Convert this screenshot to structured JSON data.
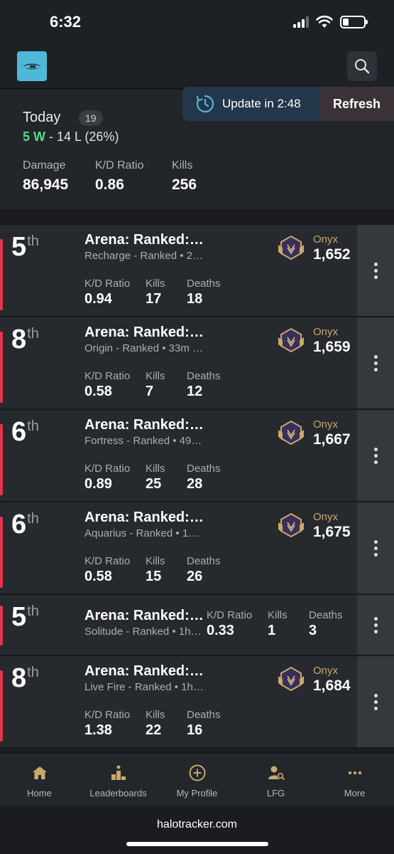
{
  "status_bar": {
    "time": "6:32"
  },
  "summary": {
    "title": "Today",
    "count": "19",
    "wins": "5 W",
    "losses": "14 L",
    "pct": "(26%)",
    "stats": [
      {
        "label": "Damage",
        "value": "86,945"
      },
      {
        "label": "K/D Ratio",
        "value": "0.86"
      },
      {
        "label": "Kills",
        "value": "256"
      }
    ],
    "update_label": "Update in 2:48",
    "refresh_label": "Refresh"
  },
  "matches": [
    {
      "place": "5",
      "suffix": "th",
      "mode": "Arena: Ranked:…",
      "sub": "Recharge - Ranked • 2…",
      "rank_label": "Onyx",
      "rank_value": "1,652",
      "kd_label": "K/D Ratio",
      "kd": "0.94",
      "kills_label": "Kills",
      "kills": "17",
      "deaths_label": "Deaths",
      "deaths": "18"
    },
    {
      "place": "8",
      "suffix": "th",
      "mode": "Arena: Ranked:…",
      "sub": "Origin - Ranked • 33m …",
      "rank_label": "Onyx",
      "rank_value": "1,659",
      "kd_label": "K/D Ratio",
      "kd": "0.58",
      "kills_label": "Kills",
      "kills": "7",
      "deaths_label": "Deaths",
      "deaths": "12"
    },
    {
      "place": "6",
      "suffix": "th",
      "mode": "Arena: Ranked:…",
      "sub": "Fortress - Ranked • 49…",
      "rank_label": "Onyx",
      "rank_value": "1,667",
      "kd_label": "K/D Ratio",
      "kd": "0.89",
      "kills_label": "Kills",
      "kills": "25",
      "deaths_label": "Deaths",
      "deaths": "28"
    },
    {
      "place": "6",
      "suffix": "th",
      "mode": "Arena: Ranked:…",
      "sub": "Aquarius - Ranked • 1…",
      "rank_label": "Onyx",
      "rank_value": "1,675",
      "kd_label": "K/D Ratio",
      "kd": "0.58",
      "kills_label": "Kills",
      "kills": "15",
      "deaths_label": "Deaths",
      "deaths": "26"
    },
    {
      "place": "5",
      "suffix": "th",
      "mode": "Arena: Ranked:…",
      "sub": "Solitude - Ranked • 1h…",
      "kd_label": "K/D Ratio",
      "kd": "0.33",
      "kills_label": "Kills",
      "kills": "1",
      "deaths_label": "Deaths",
      "deaths": "3"
    },
    {
      "place": "8",
      "suffix": "th",
      "mode": "Arena: Ranked:…",
      "sub": "Live Fire - Ranked • 1h…",
      "rank_label": "Onyx",
      "rank_value": "1,684",
      "kd_label": "K/D Ratio",
      "kd": "1.38",
      "kills_label": "Kills",
      "kills": "22",
      "deaths_label": "Deaths",
      "deaths": "16"
    }
  ],
  "nav": [
    {
      "label": "Home",
      "icon": "home-icon"
    },
    {
      "label": "Leaderboards",
      "icon": "leaderboards-icon"
    },
    {
      "label": "My Profile",
      "icon": "add-circle-icon"
    },
    {
      "label": "LFG",
      "icon": "lfg-icon"
    },
    {
      "label": "More",
      "icon": "more-icon"
    }
  ],
  "url": "halotracker.com",
  "colors": {
    "accent": "#4fb8d8",
    "loss": "#e0354d",
    "win": "#59d88b",
    "onyx": "#c9a86a"
  }
}
